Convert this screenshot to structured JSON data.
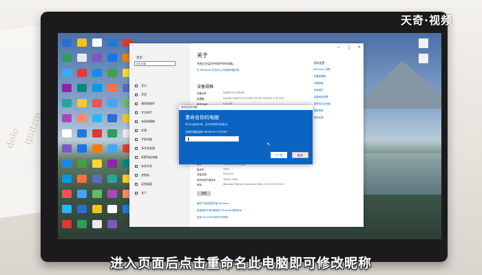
{
  "watermark": "天奇·视频",
  "subtitle": "进入页面后点击重命名此电脑即可修改昵称",
  "settings": {
    "nav_home": "主页",
    "search_placeholder": "查找设置",
    "nav_items": [
      "显示",
      "声音",
      "通知和操作",
      "专注助手",
      "电源和睡眠",
      "存储",
      "平板电脑",
      "多任务处理",
      "投影到此电脑",
      "体验共享",
      "剪贴板",
      "远程桌面",
      "关于"
    ],
    "about_title": "关于",
    "about_sub": "系统正在监控并保护你的电脑。",
    "about_link": "在 Windows 安全中心中查看详细信息",
    "spec_title": "设备规格",
    "device_specs": [
      {
        "label": "设备名称",
        "value": "DESKTOP-2T3E9KF"
      },
      {
        "label": "处理器",
        "value": "Intel(R) Core(TM) i5-9500 CPU @ 3.00GHz   3.00 GHz"
      },
      {
        "label": "机带 RAM",
        "value": "8.00 GB"
      },
      {
        "label": "设备 ID",
        "value": ""
      },
      {
        "label": "产品 ID",
        "value": ""
      },
      {
        "label": "系统类型",
        "value": ""
      },
      {
        "label": "笔和触控",
        "value": ""
      }
    ],
    "windows_specs": [
      {
        "label": "版本",
        "value": "Windows 10 专业版"
      },
      {
        "label": "版本号",
        "value": "20H2"
      },
      {
        "label": "安装日期",
        "value": "2021/1/5"
      },
      {
        "label": "操作系统内部版本",
        "value": "19042.1348"
      },
      {
        "label": "体验",
        "value": "Windows Feature Experience Pack 120.2212.3920.0"
      }
    ],
    "rename_button": "复制",
    "bottom_links": [
      "更改产品密钥或升级 Windows",
      "阅读适用于我们服务的 Microsoft 服务协议",
      "阅读 Microsoft 软件许可条款"
    ],
    "related_title": "相关设置",
    "related_links": [
      "BitLocker 设置",
      "设备管理器",
      "远程桌面",
      "系统保护",
      "高级系统设置",
      "重命名这台电脑",
      "获取帮助",
      "提供反馈"
    ]
  },
  "dialog": {
    "caption": "重命名你的电脑",
    "title": "重命名你的电脑",
    "desc": "你可以使用字母、连字符和数字的组合。",
    "current_name": "当前的电脑名称: DESKTOP-2T3E9KF",
    "next_button": "下一页",
    "cancel_button": "取消"
  },
  "desktop_icon_colors": [
    "#2a6fd6",
    "#f0c419",
    "#ffffff",
    "#1f7ad6",
    "#d83b2f",
    "#2b9f58",
    "#e9e9e9",
    "#7e57c2",
    "#1a73e8",
    "#f57c00",
    "#3fa9f5",
    "#e53935",
    "#1e88e5",
    "#43a047",
    "#fdd835",
    "#8e24aa",
    "#00897b",
    "#039be5",
    "#ff7043",
    "#5c6bc0",
    "#26a69a",
    "#ffca28",
    "#ef5350",
    "#42a5f5",
    "#66bb6a",
    "#ab47bc",
    "#ff8a65",
    "#29b6f6"
  ]
}
